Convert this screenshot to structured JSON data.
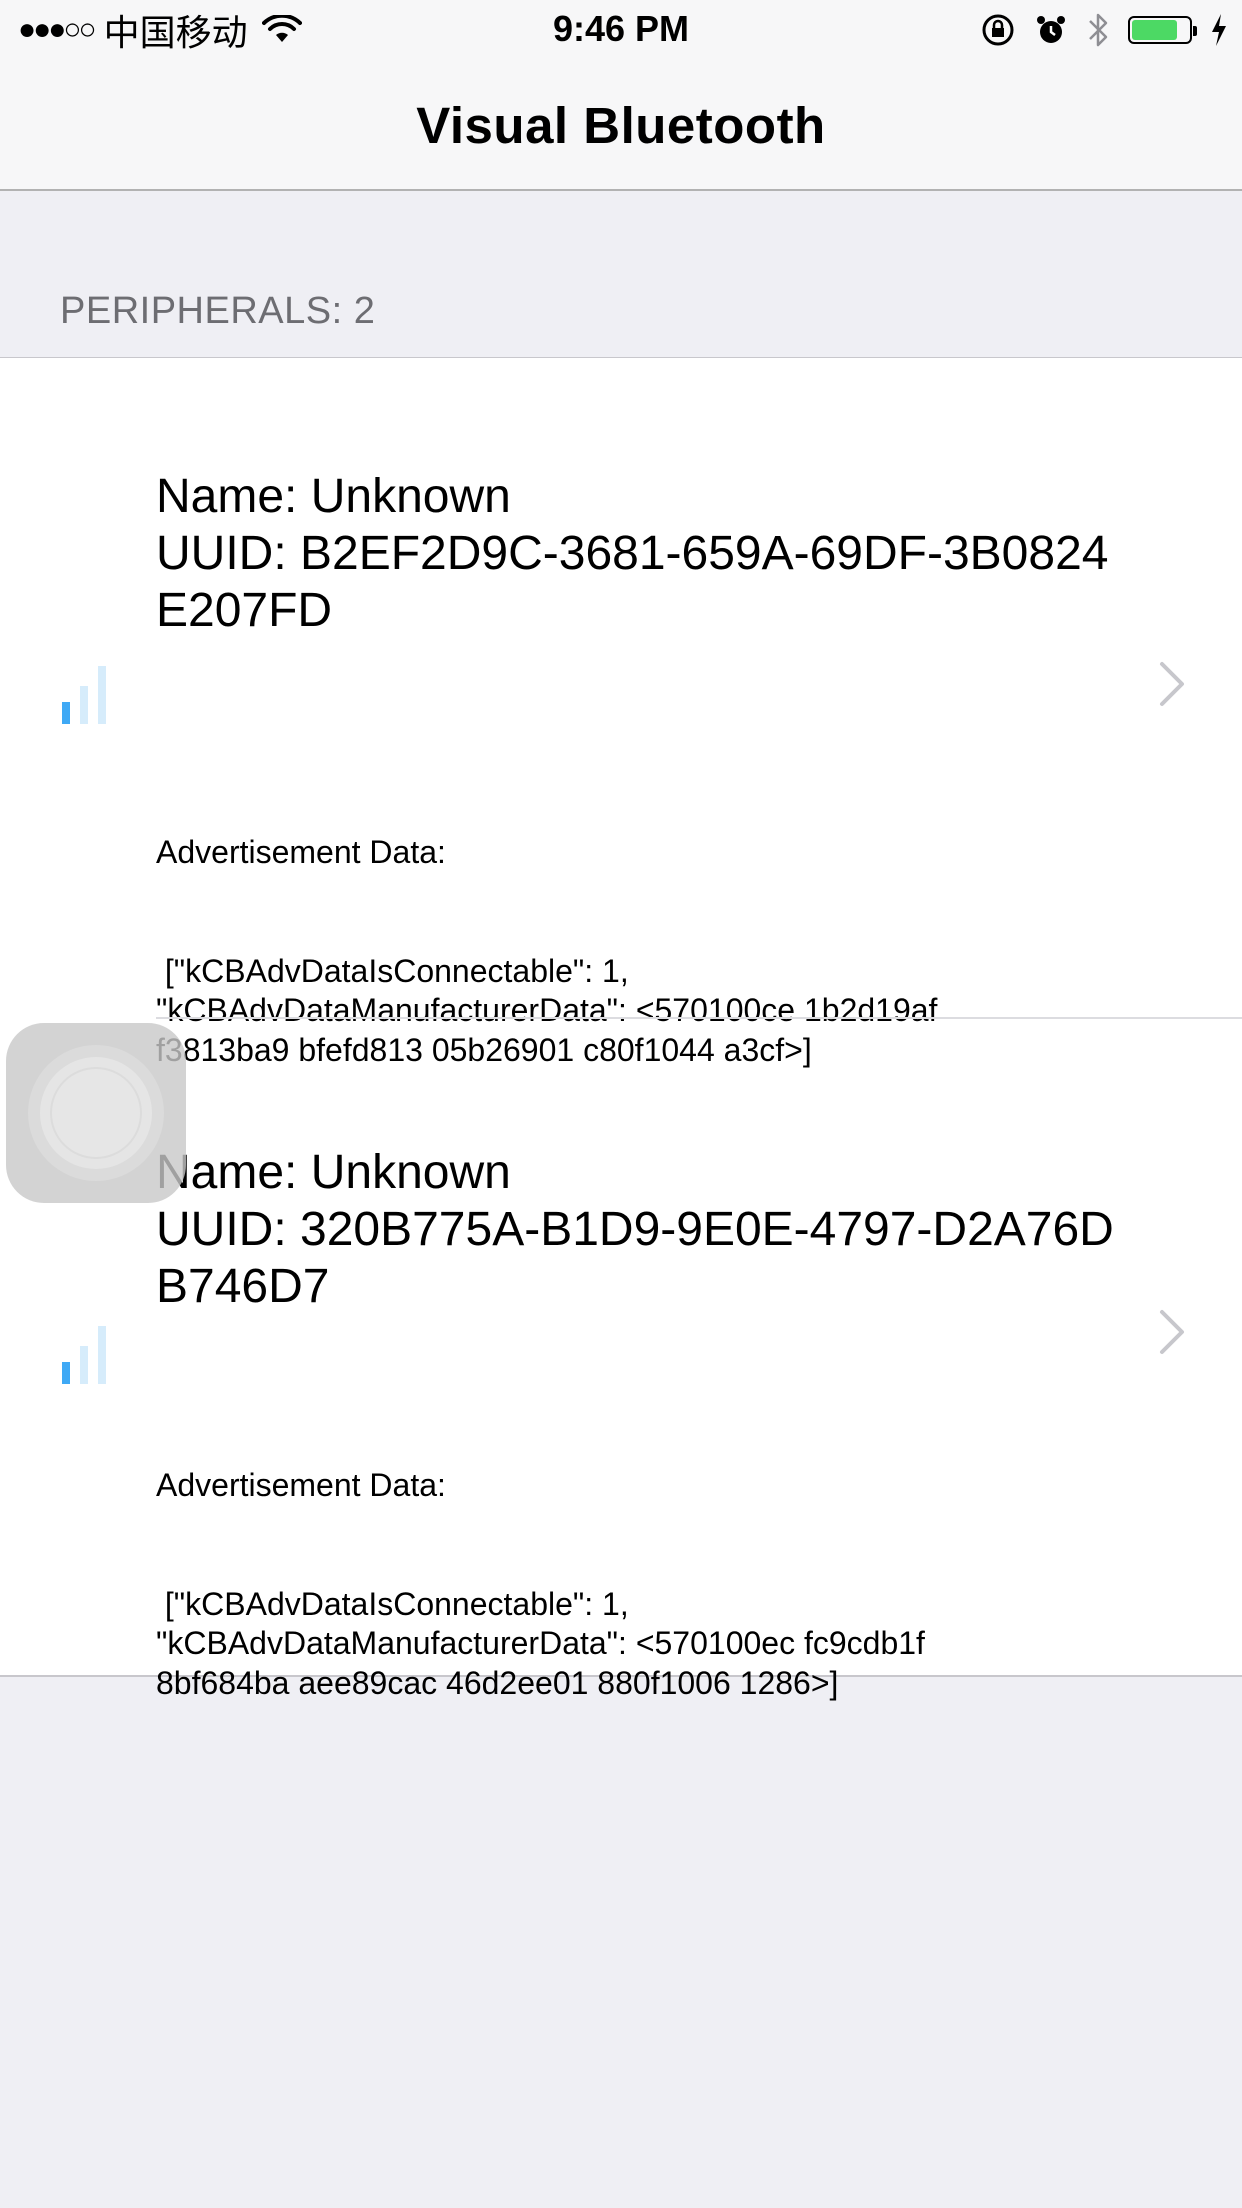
{
  "status_bar": {
    "signal": "●●●○○",
    "carrier": "中国移动",
    "time": "9:46 PM",
    "battery_level": 0.8,
    "icons": [
      "wifi-icon",
      "orientation-lock-icon",
      "alarm-icon",
      "bluetooth-icon",
      "battery-icon",
      "charging-icon"
    ]
  },
  "nav": {
    "title": "Visual Bluetooth"
  },
  "section": {
    "header": "PERIPHERALS: 2"
  },
  "peripherals": [
    {
      "name_line": "Name: Unknown",
      "uuid_line": "UUID: B2EF2D9C-3681-659A-69DF-3B0824E207FD",
      "adv_label": "Advertisement Data:",
      "adv_data": " [\"kCBAdvDataIsConnectable\": 1, \"kCBAdvDataManufacturerData\": <570100ce 1b2d19af f3813ba9 bfefd813 05b26901 c80f1044 a3cf>]",
      "signal_bars": 1
    },
    {
      "name_line": "Name: Unknown",
      "uuid_line": "UUID: 320B775A-B1D9-9E0E-4797-D2A76DB746D7",
      "adv_label": "Advertisement Data:",
      "adv_data": " [\"kCBAdvDataIsConnectable\": 1, \"kCBAdvDataManufacturerData\": <570100ec fc9cdb1f 8bf684ba aee89cac 46d2ee01 880f1006 1286>]",
      "signal_bars": 1
    }
  ],
  "colors": {
    "signal_active": "#3fa9f5",
    "signal_inactive": "#d6ecfb",
    "chevron": "#c7c7cc",
    "battery": "#4cd964"
  }
}
